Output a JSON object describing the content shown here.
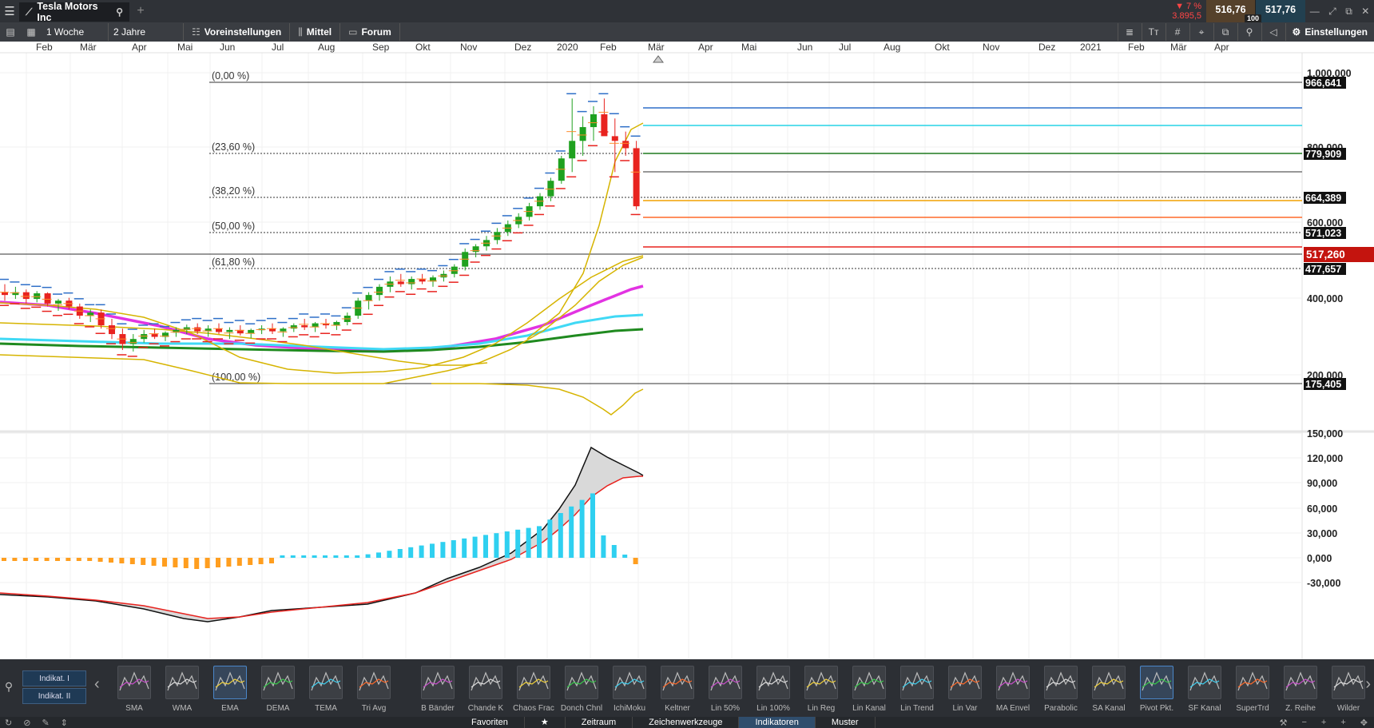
{
  "header": {
    "symbol": "Tesla Motors Inc",
    "change_pct": "▼ 7 %",
    "change_abs": "3.895,5",
    "bid": "516,76",
    "ask": "517,76",
    "spread_badge": "100"
  },
  "toolbar": {
    "interval": "1 Woche",
    "range": "2 Jahre",
    "presets": "Voreinstellungen",
    "chart_type": "Mittel",
    "forum": "Forum",
    "settings": "Einstellungen"
  },
  "chart_data": {
    "type": "candlestick",
    "x_labels": [
      "Feb",
      "Mär",
      "Apr",
      "Mai",
      "Jun",
      "Jul",
      "Aug",
      "Sep",
      "Okt",
      "Nov",
      "Dez",
      "2020",
      "Feb",
      "Mär",
      "Apr",
      "Mai",
      "Jun",
      "Jul",
      "Aug",
      "Okt",
      "Nov",
      "Dez",
      "2021",
      "Feb",
      "Mär",
      "Apr"
    ],
    "y_ticks_main": [
      "1.000,000",
      "800,000",
      "600,000",
      "400,000",
      "200,000"
    ],
    "y_ticks_osc": [
      "150,000",
      "120,000",
      "90,000",
      "60,000",
      "30,000",
      "0,000",
      "-30,000"
    ],
    "fib_levels": [
      {
        "label": "(0,00 %)",
        "price": "966,641"
      },
      {
        "label": "(23,60 %)",
        "price": "779,909"
      },
      {
        "label": "(38,20 %)",
        "price": "664,389"
      },
      {
        "label": "(50,00 %)",
        "price": "571,023"
      },
      {
        "label": "(61,80 %)",
        "price": "477,657"
      },
      {
        "label": "(100,00 %)",
        "price": "175,405"
      }
    ],
    "current_price": "517,260",
    "pivot_colors": [
      "#2e6fc8",
      "#27d4e6",
      "#1f7a1f",
      "#777777",
      "#f2a100",
      "#ff6a2a",
      "#e8231f"
    ],
    "candles": [
      [
        330,
        345,
        315,
        325
      ],
      [
        325,
        340,
        318,
        330
      ],
      [
        330,
        335,
        310,
        318
      ],
      [
        318,
        332,
        312,
        328
      ],
      [
        328,
        330,
        305,
        310
      ],
      [
        310,
        318,
        298,
        315
      ],
      [
        315,
        320,
        300,
        305
      ],
      [
        305,
        310,
        285,
        290
      ],
      [
        290,
        300,
        280,
        295
      ],
      [
        295,
        300,
        270,
        275
      ],
      [
        275,
        285,
        255,
        262
      ],
      [
        262,
        270,
        240,
        248
      ],
      [
        248,
        262,
        238,
        255
      ],
      [
        255,
        268,
        250,
        262
      ],
      [
        262,
        270,
        255,
        258
      ],
      [
        258,
        266,
        252,
        264
      ],
      [
        264,
        272,
        258,
        268
      ],
      [
        268,
        276,
        262,
        272
      ],
      [
        272,
        278,
        262,
        266
      ],
      [
        266,
        275,
        258,
        270
      ],
      [
        270,
        278,
        262,
        265
      ],
      [
        265,
        272,
        255,
        268
      ],
      [
        268,
        275,
        260,
        263
      ],
      [
        263,
        270,
        256,
        268
      ],
      [
        268,
        275,
        262,
        270
      ],
      [
        270,
        278,
        262,
        266
      ],
      [
        266,
        272,
        258,
        270
      ],
      [
        270,
        278,
        265,
        275
      ],
      [
        275,
        285,
        268,
        272
      ],
      [
        272,
        280,
        265,
        278
      ],
      [
        278,
        285,
        270,
        275
      ],
      [
        275,
        282,
        268,
        280
      ],
      [
        280,
        295,
        275,
        290
      ],
      [
        290,
        320,
        285,
        315
      ],
      [
        315,
        330,
        300,
        325
      ],
      [
        325,
        345,
        315,
        340
      ],
      [
        340,
        360,
        330,
        350
      ],
      [
        350,
        365,
        340,
        345
      ],
      [
        345,
        360,
        335,
        355
      ],
      [
        355,
        365,
        345,
        350
      ],
      [
        350,
        362,
        340,
        358
      ],
      [
        358,
        372,
        350,
        365
      ],
      [
        365,
        385,
        358,
        380
      ],
      [
        380,
        420,
        372,
        412
      ],
      [
        412,
        430,
        400,
        425
      ],
      [
        425,
        450,
        415,
        440
      ],
      [
        440,
        470,
        430,
        460
      ],
      [
        460,
        490,
        450,
        480
      ],
      [
        480,
        510,
        470,
        500
      ],
      [
        500,
        540,
        490,
        530
      ],
      [
        530,
        570,
        520,
        560
      ],
      [
        560,
        620,
        545,
        610
      ],
      [
        610,
        700,
        600,
        690
      ],
      [
        690,
        960,
        640,
        760
      ],
      [
        760,
        870,
        700,
        820
      ],
      [
        820,
        920,
        760,
        880
      ],
      [
        880,
        960,
        820,
        780
      ],
      [
        780,
        860,
        640,
        760
      ],
      [
        760,
        800,
        700,
        730
      ],
      [
        730,
        760,
        520,
        530
      ]
    ]
  },
  "indicator_tabs": [
    "Indikat. I",
    "Indikat. II"
  ],
  "indicators": [
    "SMA",
    "WMA",
    "EMA",
    "DEMA",
    "TEMA",
    "Tri Avg",
    "B Bänder",
    "Chande K",
    "Chaos Frac",
    "Donch Chnl",
    "IchiMoku",
    "Keltner",
    "Lin 50%",
    "Lin 100%",
    "Lin Reg",
    "Lin Kanal",
    "Lin Trend",
    "Lin Var",
    "MA Envel",
    "Parabolic",
    "SA Kanal",
    "Pivot Pkt.",
    "SF Kanal",
    "SuperTrd",
    "Z. Reihe",
    "Wilder"
  ],
  "footer_tabs": [
    "Favoriten",
    "Zeitraum",
    "Zeichenwerkzeuge",
    "Indikatoren",
    "Muster"
  ]
}
